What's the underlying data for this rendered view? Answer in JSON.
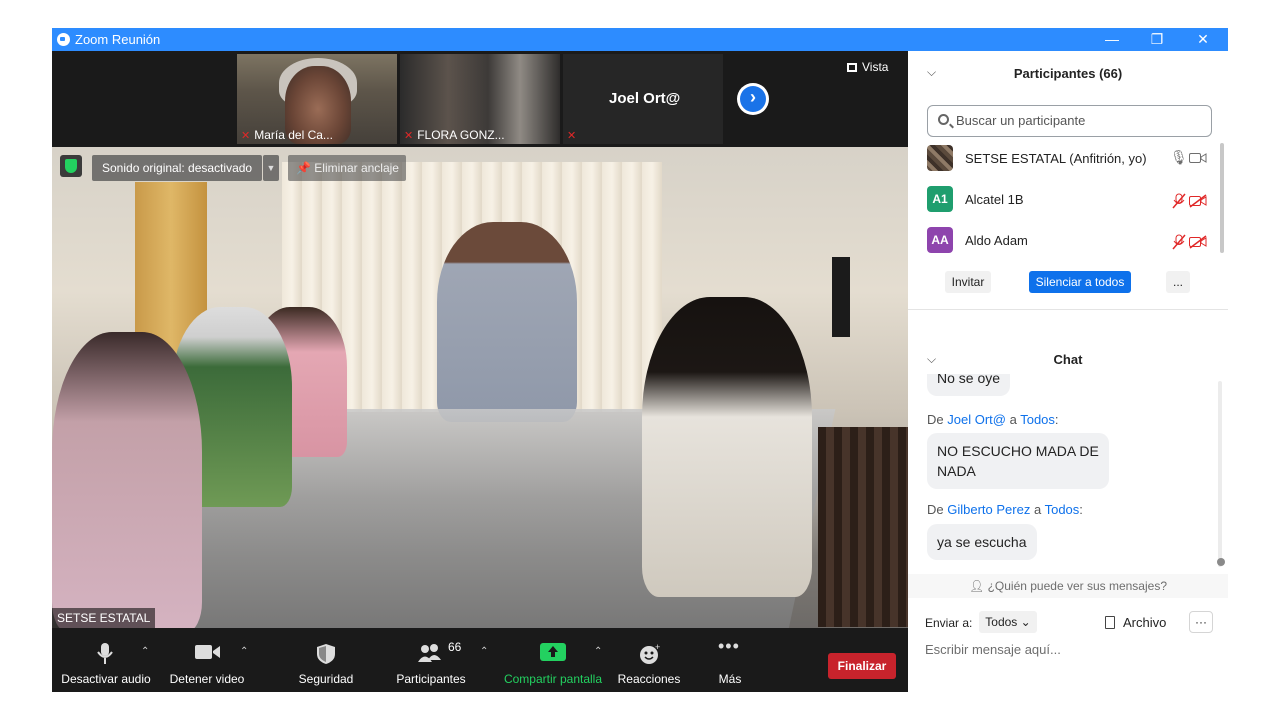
{
  "window": {
    "title": "Zoom Reunión",
    "controls": [
      "—",
      "❐",
      "✕"
    ]
  },
  "strip": {
    "thumbs": [
      {
        "name": "María del Ca..."
      },
      {
        "name": "FLORA GONZ..."
      },
      {
        "name": ""
      }
    ],
    "active_speaker": "Joel Ort@",
    "view_label": "Vista"
  },
  "main_video": {
    "sound_label": "Sonido original: desactivado",
    "unpin_label": "Eliminar anclaje",
    "participant_name": "SETSE ESTATAL"
  },
  "toolbar": {
    "audio": "Desactivar audio",
    "video": "Detener video",
    "security": "Seguridad",
    "participants": "Participantes",
    "participants_count": "66",
    "share": "Compartir pantalla",
    "reactions": "Reacciones",
    "more": "Más",
    "end": "Finalizar"
  },
  "participants_panel": {
    "title": "Participantes (66)",
    "search_placeholder": "Buscar un participante",
    "list": [
      {
        "initials": "",
        "name": "SETSE ESTATAL (Anfitrión, yo)",
        "color": "#6a5a4a"
      },
      {
        "initials": "A1",
        "name": "Alcatel 1B",
        "color": "#1f9e6e"
      },
      {
        "initials": "AA",
        "name": "Aldo Adam",
        "color": "#8e44ad"
      }
    ],
    "invite": "Invitar",
    "mute_all": "Silenciar a todos",
    "more": "..."
  },
  "chat": {
    "title": "Chat",
    "partial_message": "No se oye",
    "messages": [
      {
        "from": "Joel Ort@",
        "to": "Todos",
        "text_lines": [
          "NO ESCUCHO MADA DE",
          "NADA"
        ]
      },
      {
        "from": "Gilberto Perez",
        "to": "Todos",
        "text_lines": [
          "ya se escucha"
        ]
      }
    ],
    "de": "De",
    "a": "a",
    "who_sees": "¿Quién puede ver sus mensajes?",
    "send_to_label": "Enviar a:",
    "send_to_value": "Todos",
    "file_label": "Archivo",
    "more": "···",
    "input_placeholder": "Escribir mensaje aquí..."
  },
  "colors": {
    "accent": "#2d8cff",
    "blue_button": "#0e71eb",
    "end_red": "#c8232c",
    "share_green": "#23d160"
  }
}
